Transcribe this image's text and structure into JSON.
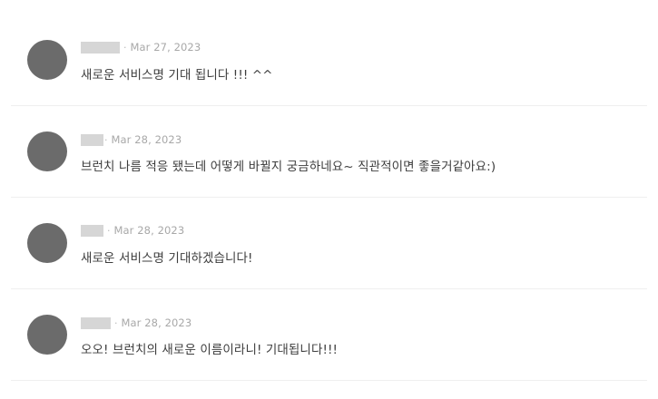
{
  "comments": [
    {
      "separator": "·",
      "date": "Mar 27, 2023",
      "text": "새로운 서비스명 기대 됩니다 !!! ^^"
    },
    {
      "separator": "·",
      "date": "Mar 28, 2023",
      "text": "브런치 나름 적응 됐는데 어떻게 바뀔지 궁금하네요~ 직관적이면 좋을거같아요:)"
    },
    {
      "separator": "·",
      "date": "Mar 28, 2023",
      "text": "새로운 서비스명 기대하겠습니다!"
    },
    {
      "separator": "·",
      "date": "Mar 28, 2023",
      "text": "오오! 브런치의 새로운 이름이라니! 기대됩니다!!!"
    }
  ]
}
